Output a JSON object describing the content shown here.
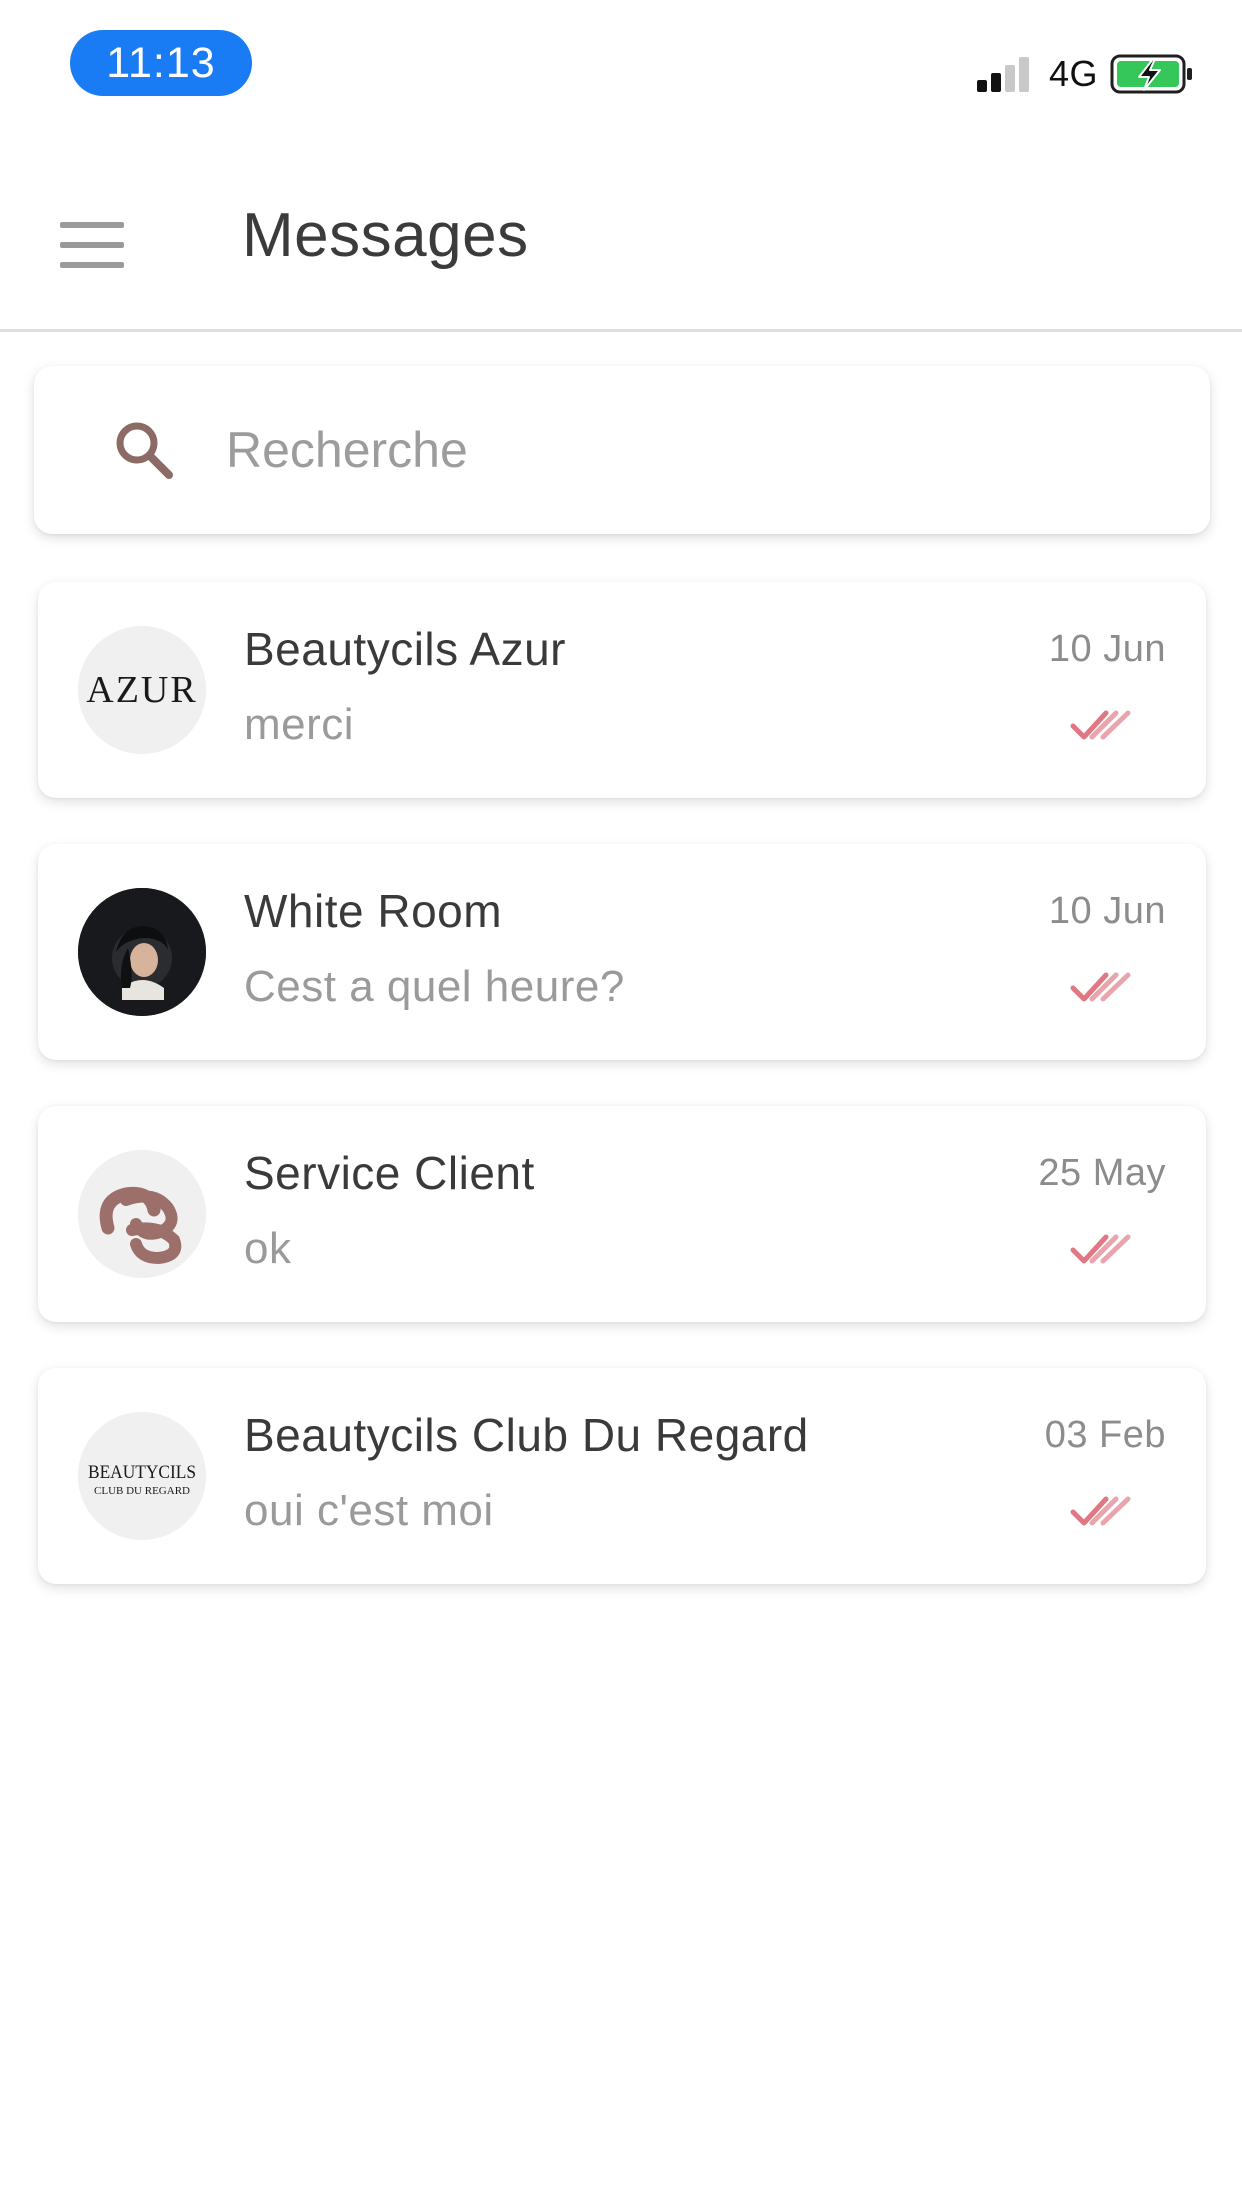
{
  "status_bar": {
    "time": "11:13",
    "network": "4G",
    "icons": [
      "cellular-signal-icon",
      "battery-charging-icon"
    ]
  },
  "header": {
    "title": "Messages",
    "menu_icon": "hamburger-menu-icon"
  },
  "search": {
    "placeholder": "Recherche",
    "value": "",
    "icon": "search-icon"
  },
  "conversations": [
    {
      "name": "Beautycils Azur",
      "preview": "merci",
      "date": "10 Jun",
      "avatar_text": "AZUR",
      "status_icon": "double-check-read-icon"
    },
    {
      "name": "White Room",
      "preview": "Cest a quel heure?",
      "date": "10 Jun",
      "status_icon": "double-check-read-icon"
    },
    {
      "name": "Service Client",
      "preview": "ok",
      "date": "25 May",
      "status_icon": "double-check-read-icon"
    },
    {
      "name": "Beautycils Club Du Regard",
      "preview": "oui c'est moi",
      "date": "03 Feb",
      "avatar_text": "BEAUTYCILS",
      "avatar_subtext": "CLUB DU REGARD",
      "status_icon": "double-check-read-icon"
    }
  ],
  "colors": {
    "time_pill": "#1a7cf5",
    "accent": "#8c6b66",
    "read_check": "#e07884",
    "battery_fill": "#35c759",
    "title_text": "#3b3b3b",
    "secondary_text": "#9a9a9a"
  }
}
